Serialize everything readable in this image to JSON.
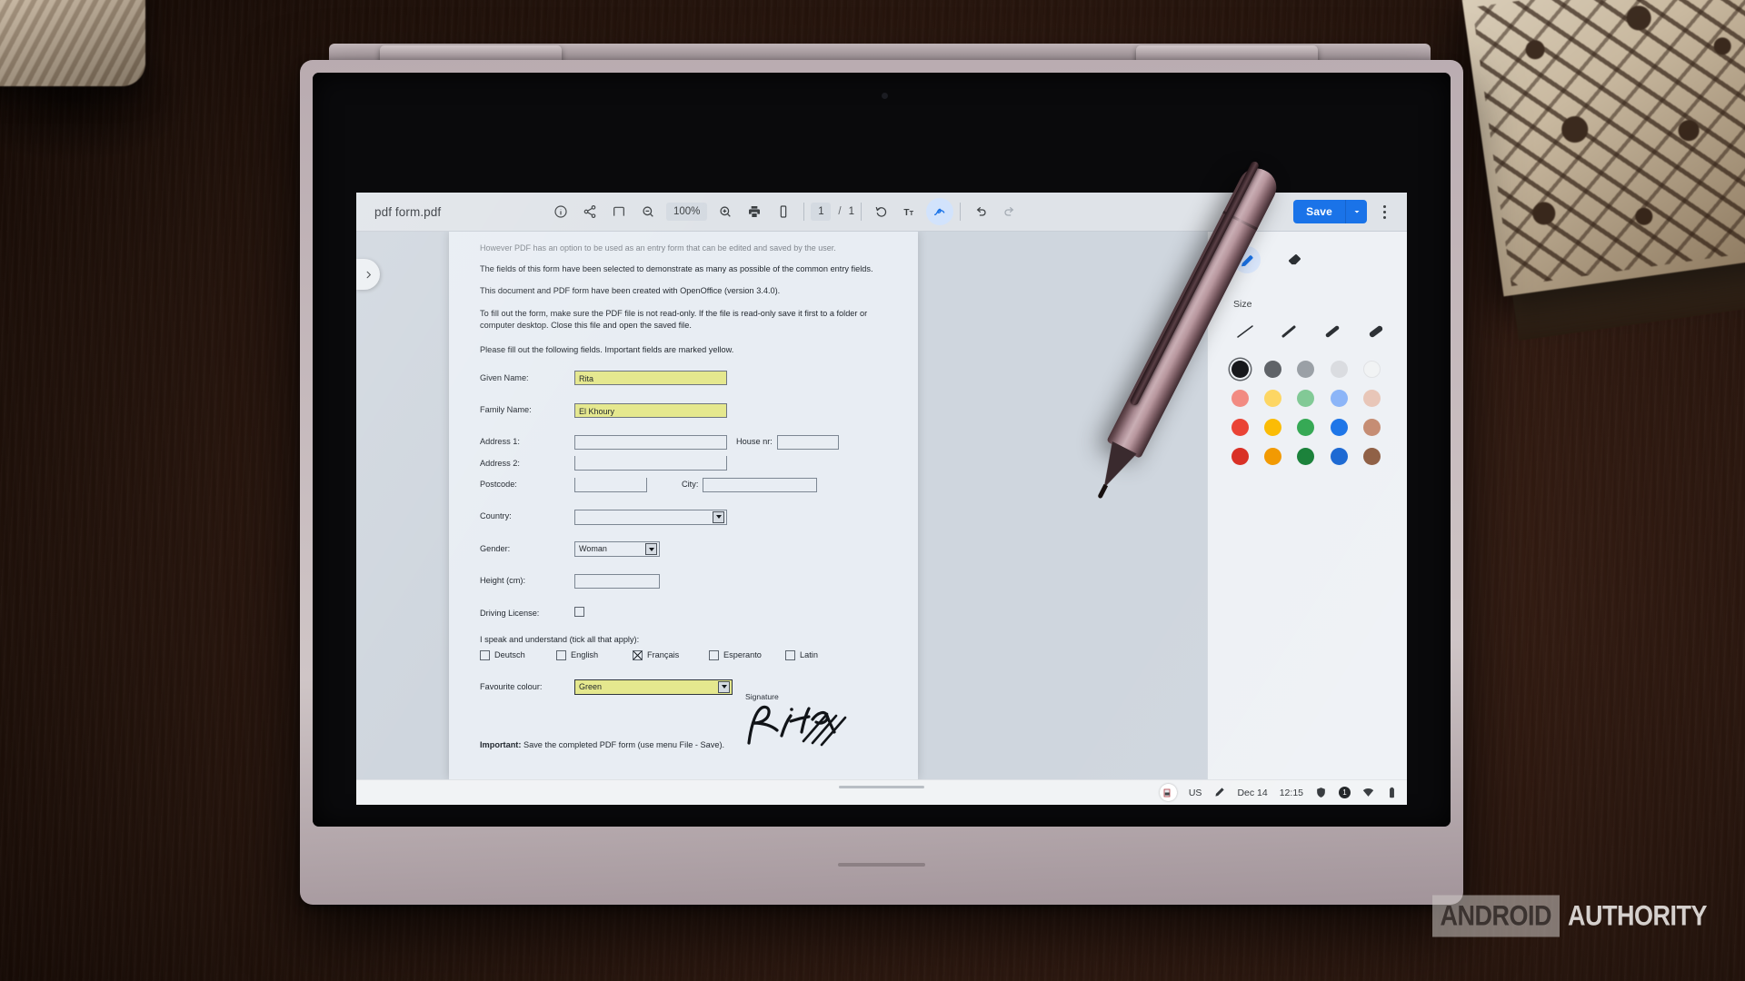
{
  "app": {
    "document_title": "pdf form.pdf",
    "zoom_level": "100%",
    "page_current": "1",
    "page_separator": "/",
    "page_total": "1",
    "save_label": "Save",
    "toolbar_icons": [
      {
        "name": "info-icon",
        "label": "Document info"
      },
      {
        "name": "share-icon",
        "label": "Share"
      },
      {
        "name": "fit-page-icon",
        "label": "Fit to page"
      },
      {
        "name": "zoom-out-icon",
        "label": "Zoom out"
      },
      {
        "name": "zoom-in-icon",
        "label": "Zoom in"
      },
      {
        "name": "print-icon",
        "label": "Print"
      },
      {
        "name": "mobile-view-icon",
        "label": "Two page view"
      },
      {
        "name": "rotate-icon",
        "label": "Rotate"
      },
      {
        "name": "text-annotate-icon",
        "label": "Text"
      },
      {
        "name": "draw-annotate-icon",
        "label": "Draw"
      },
      {
        "name": "undo-icon",
        "label": "Undo"
      },
      {
        "name": "redo-icon",
        "label": "Redo"
      },
      {
        "name": "more-options-icon",
        "label": "More"
      }
    ]
  },
  "document": {
    "cut_line": "However PDF has an option to be used as an entry form that can be edited and saved by the user.",
    "paragraphs": [
      "The fields of this form have been selected to demonstrate as many as possible of the common entry fields.",
      "This document and PDF form have been created with OpenOffice (version 3.4.0).",
      "To fill out the form, make sure the PDF file is not read-only. If the file is read-only save it first to a folder or computer desktop. Close this file and open the saved file.",
      "Please fill out the following fields. Important fields are marked yellow."
    ],
    "fields": {
      "given_name_label": "Given Name:",
      "given_name_value": "Rita",
      "family_name_label": "Family Name:",
      "family_name_value": "El Khoury",
      "address1_label": "Address 1:",
      "address1_value": "",
      "address2_label": "Address 2:",
      "address2_value": "",
      "house_nr_label": "House nr:",
      "house_nr_value": "",
      "postcode_label": "Postcode:",
      "postcode_value": "",
      "city_label": "City:",
      "city_value": "",
      "country_label": "Country:",
      "country_value": "",
      "gender_label": "Gender:",
      "gender_value": "Woman",
      "height_label": "Height (cm):",
      "height_value": "",
      "driving_license_label": "Driving License:",
      "driving_license_checked": false,
      "languages_prompt": "I speak and understand (tick all that apply):",
      "languages": [
        {
          "label": "Deutsch",
          "checked": false
        },
        {
          "label": "English",
          "checked": false
        },
        {
          "label": "Français",
          "checked": true
        },
        {
          "label": "Esperanto",
          "checked": false
        },
        {
          "label": "Latin",
          "checked": false
        }
      ],
      "colour_label": "Favourite colour:",
      "colour_value": "Green"
    },
    "important_bold": "Important:",
    "important_rest": " Save the completed PDF form (use menu File - Save).",
    "signature_label": "Signature",
    "signature_ink": "Rita"
  },
  "annotation_panel": {
    "tools": [
      {
        "name": "pen-tool",
        "label": "Pen",
        "selected": true
      },
      {
        "name": "eraser-tool",
        "label": "Eraser",
        "selected": false
      }
    ],
    "size_label": "Size",
    "stroke_sizes": [
      1.5,
      2.5,
      4,
      6
    ],
    "selected_stroke_index": 1,
    "palette": [
      [
        "#17181c",
        "#5f6368",
        "#9aa0a6",
        "#dadce0",
        "#f1f3f4"
      ],
      [
        "#f28b82",
        "#fdd663",
        "#81c995",
        "#8ab4f8",
        "#e8c5b6"
      ],
      [
        "#ea4335",
        "#fbbc04",
        "#34a853",
        "#1a73e8",
        "#c48a70"
      ],
      [
        "#d93025",
        "#f29900",
        "#188038",
        "#1967d2",
        "#8d5c41"
      ]
    ],
    "selected_color": "#17181c"
  },
  "shelf": {
    "keyboard_layout": "US",
    "date": "Dec 14",
    "time": "12:15",
    "notification_count": "1",
    "icons": [
      {
        "name": "app-launcher-icon"
      },
      {
        "name": "stylus-icon"
      },
      {
        "name": "shield-icon"
      },
      {
        "name": "notification-badge-icon"
      },
      {
        "name": "wifi-icon"
      },
      {
        "name": "battery-icon"
      }
    ]
  },
  "watermark": {
    "part_one": "ANDROID",
    "part_two": "AUTHORITY"
  }
}
